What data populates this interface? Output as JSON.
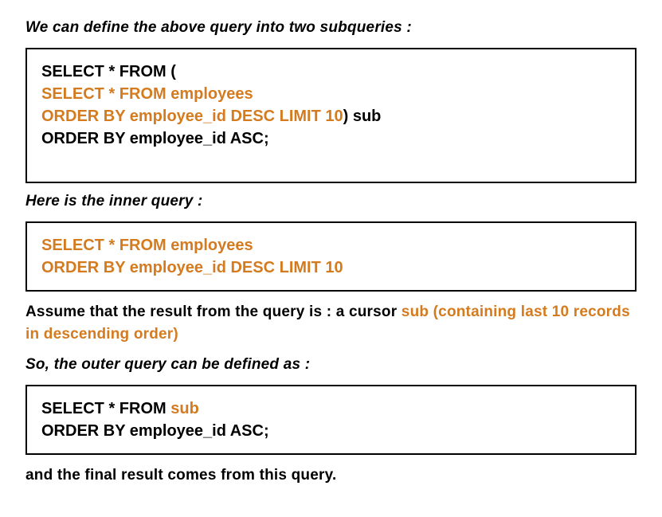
{
  "intro1": "We can define the above query into two subqueries :",
  "box1": {
    "line1": "SELECT * FROM (",
    "line2": "SELECT * FROM employees",
    "line3_a": "ORDER BY employee_id DESC LIMIT 10",
    "line3_b": ") sub",
    "line4": "ORDER BY employee_id ASC;"
  },
  "intro2": "Here is the inner query :",
  "box2": {
    "line1": "SELECT * FROM employees",
    "line2": "ORDER BY employee_id DESC LIMIT 10"
  },
  "assume_a": "Assume that the result from the query is : a cursor ",
  "assume_b": "sub (containing last 10 records in descending order)",
  "intro3": "So, the outer query can be defined as :",
  "box3": {
    "line1_a": "SELECT * FROM ",
    "line1_b": "sub",
    "line2": "ORDER BY employee_id ASC;"
  },
  "final": "and the final result comes from this query."
}
